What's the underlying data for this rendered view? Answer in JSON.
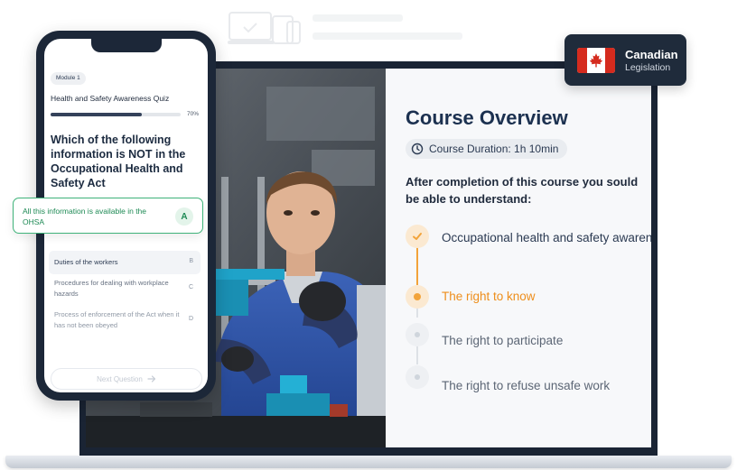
{
  "phone": {
    "module_label": "Module 1",
    "quiz_title": "Health and Safety Awareness Quiz",
    "progress_percent": 70,
    "progress_label": "70%",
    "question": "Which of the following information is NOT in the Occupational Health and Safety Act",
    "options": [
      {
        "letter": "A",
        "text": "All this information is available in the OHSA",
        "state": "correct"
      },
      {
        "letter": "B",
        "text": "Duties of the workers",
        "state": "default"
      },
      {
        "letter": "C",
        "text": "Procedures for dealing with workplace hazards",
        "state": "default"
      },
      {
        "letter": "D",
        "text": "Process of enforcement of the Act when it has not been obeyed",
        "state": "default"
      }
    ],
    "next_button_label": "Next Question",
    "next_icon": "arrow-right-icon"
  },
  "badge": {
    "title": "Canadian",
    "subtitle": "Legislation",
    "flag_icon": "canada-flag-icon"
  },
  "course": {
    "title": "Course Overview",
    "duration_icon": "clock-icon",
    "duration": "Course Duration: 1h 10min",
    "intro": "After completion of this course you sould be able to understand:",
    "steps": [
      {
        "label": "Occupational health and safety awareness",
        "state": "done"
      },
      {
        "label": "The right to know",
        "state": "current"
      },
      {
        "label": "The right to participate",
        "state": "todo"
      },
      {
        "label": "The right to refuse unsafe work",
        "state": "todo"
      }
    ]
  },
  "colors": {
    "accent": "#f2a33a",
    "current_step_text": "#ee8e1b",
    "correct_green": "#3fb37a",
    "laptop_frame": "#1a2434",
    "heading": "#1c3150"
  }
}
